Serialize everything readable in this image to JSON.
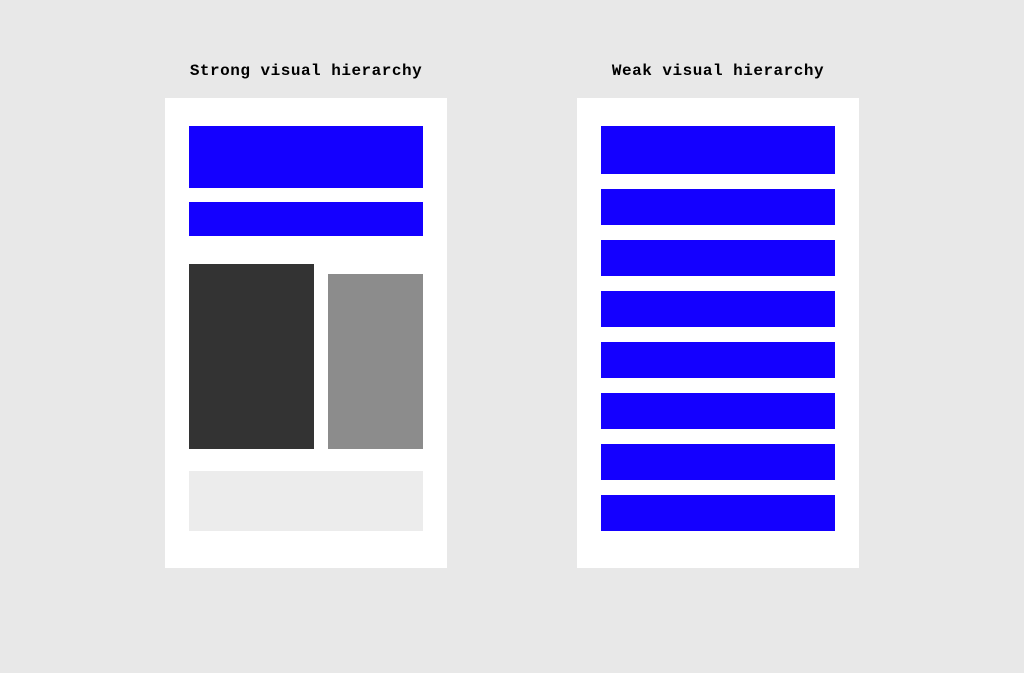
{
  "diagram": {
    "left": {
      "title": "Strong visual hierarchy",
      "blocks": [
        {
          "name": "header-large",
          "color": "#1400ff"
        },
        {
          "name": "subheader",
          "color": "#1400ff"
        },
        {
          "name": "content-primary",
          "color": "#333333"
        },
        {
          "name": "content-secondary",
          "color": "#8c8c8c"
        },
        {
          "name": "content-tertiary",
          "color": "#ececec"
        }
      ]
    },
    "right": {
      "title": "Weak visual hierarchy",
      "blocks": [
        {
          "name": "row-1",
          "color": "#1400ff"
        },
        {
          "name": "row-2",
          "color": "#1400ff"
        },
        {
          "name": "row-3",
          "color": "#1400ff"
        },
        {
          "name": "row-4",
          "color": "#1400ff"
        },
        {
          "name": "row-5",
          "color": "#1400ff"
        },
        {
          "name": "row-6",
          "color": "#1400ff"
        },
        {
          "name": "row-7",
          "color": "#1400ff"
        },
        {
          "name": "row-8",
          "color": "#1400ff"
        }
      ]
    }
  },
  "colors": {
    "background": "#e8e8e8",
    "panel": "#ffffff",
    "accent": "#1400ff",
    "dark": "#333333",
    "gray": "#8c8c8c",
    "light": "#ececec"
  }
}
